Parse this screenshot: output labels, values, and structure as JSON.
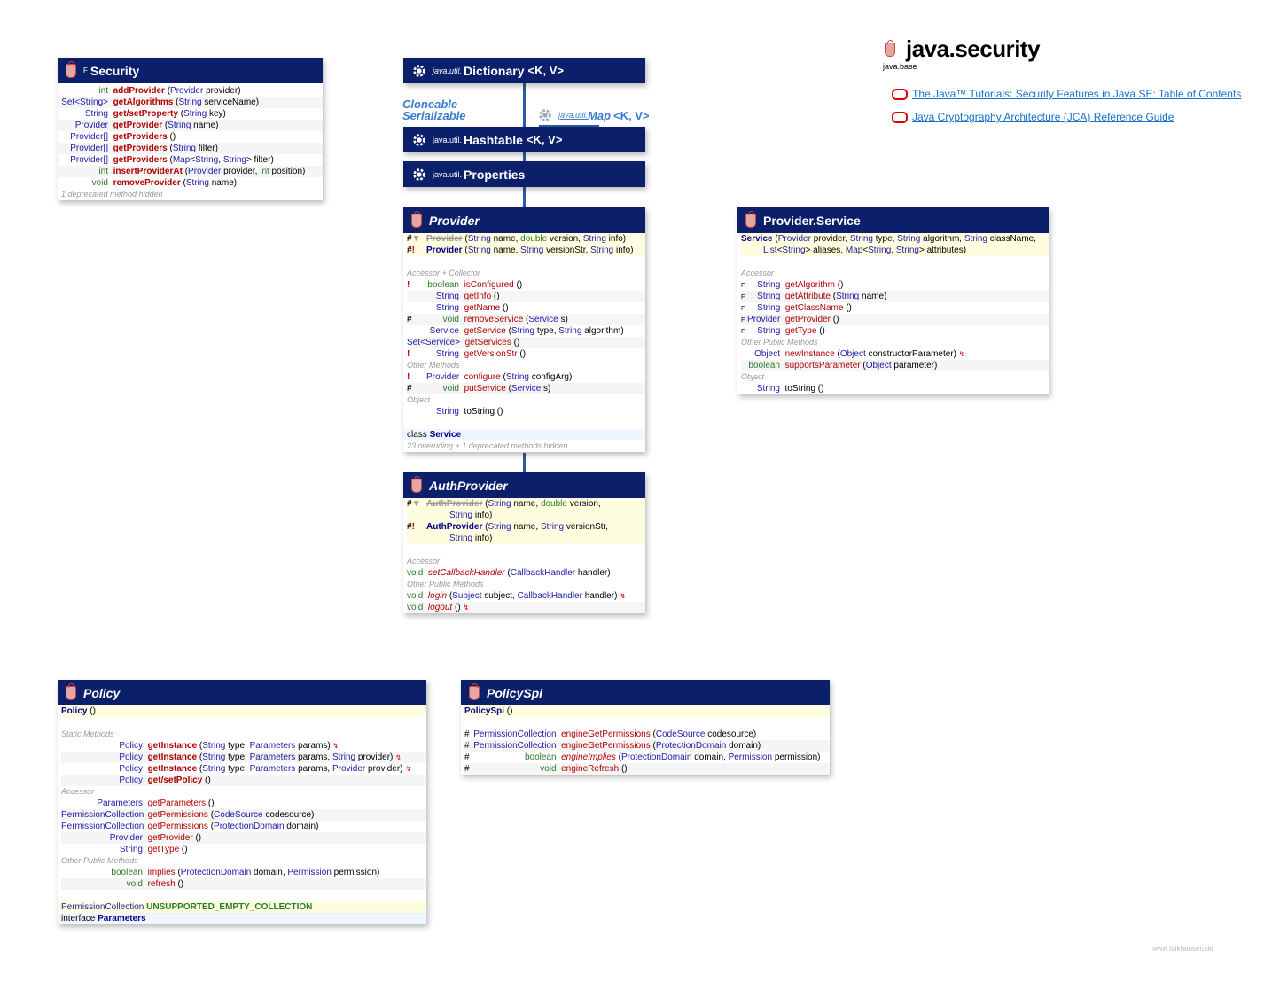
{
  "title": {
    "name": "java.security",
    "module": "java.base"
  },
  "links": [
    {
      "text": "The Java™ Tutorials: Security Features in Java SE: Table of Contents"
    },
    {
      "text": "Java Cryptography Architecture (JCA) Reference Guide"
    }
  ],
  "watermark": "www.falkhausen.de",
  "inherit": {
    "dictionary": {
      "pkg": "java.util.",
      "name": "Dictionary",
      "tp": "<K, V>"
    },
    "hashtable": {
      "pkg": "java.util.",
      "name": "Hashtable",
      "tp": "<K, V>"
    },
    "properties": {
      "pkg": "java.util.",
      "name": "Properties"
    },
    "map": {
      "pkg": "java.util.",
      "name": "Map",
      "tp": "<K, V>"
    },
    "cloneable": "Cloneable",
    "serializable": "Serializable"
  },
  "security": {
    "fin": "F",
    "name": "Security",
    "rows": [
      {
        "t": "int",
        "m": "addProvider",
        "p": [
          [
            "(",
            "t"
          ],
          [
            "Provider",
            "c"
          ],
          [
            " provider)",
            "t"
          ]
        ]
      },
      {
        "t": "Set<String>",
        "m": "getAlgorithms",
        "p": [
          [
            "(",
            "t"
          ],
          [
            "String",
            "c"
          ],
          [
            " serviceName)",
            "t"
          ]
        ]
      },
      {
        "t": "String",
        "m": "get/setProperty",
        "p": [
          [
            "(",
            "t"
          ],
          [
            "String",
            "c"
          ],
          [
            " key)",
            "t"
          ]
        ]
      },
      {
        "t": "Provider",
        "m": "getProvider",
        "p": [
          [
            "(",
            "t"
          ],
          [
            "String",
            "c"
          ],
          [
            " name)",
            "t"
          ]
        ]
      },
      {
        "t": "Provider[]",
        "m": "getProviders",
        "p": [
          [
            "()",
            "t"
          ]
        ]
      },
      {
        "t": "Provider[]",
        "m": "getProviders",
        "p": [
          [
            "(",
            "t"
          ],
          [
            "String",
            "c"
          ],
          [
            " filter)",
            "t"
          ]
        ]
      },
      {
        "t": "Provider[]",
        "m": "getProviders",
        "p": [
          [
            "(",
            "t"
          ],
          [
            "Map",
            "c"
          ],
          [
            "<",
            "t"
          ],
          [
            "String",
            "c"
          ],
          [
            ", ",
            "t"
          ],
          [
            "String",
            "c"
          ],
          [
            "> filter)",
            "t"
          ]
        ]
      },
      {
        "t": "int",
        "m": "insertProviderAt",
        "p": [
          [
            "(",
            "t"
          ],
          [
            "Provider",
            "c"
          ],
          [
            " provider, ",
            "t"
          ],
          [
            "int",
            "c"
          ],
          [
            " position)",
            "t"
          ]
        ]
      },
      {
        "t": "void",
        "m": "removeProvider",
        "p": [
          [
            "(",
            "t"
          ],
          [
            "String",
            "c"
          ],
          [
            " name)",
            "t"
          ]
        ]
      }
    ],
    "footer": "1 deprecated method hidden"
  },
  "provider": {
    "name": "Provider",
    "ctor1": "Provider (String name, double version, String info)",
    "ctor2": "Provider (String name, String versionStr, String info)",
    "sec_accessor": "Accessor + Collector",
    "sec_other": "Other Methods",
    "sec_object": "Object",
    "inner": "class Service",
    "footer": "23 overriding + 1 deprecated methods hidden"
  },
  "authprovider": {
    "name": "AuthProvider",
    "sec_accessor": "Accessor",
    "sec_other": "Other Public Methods"
  },
  "service": {
    "name": "Provider.Service",
    "sec_accessor": "Accessor",
    "sec_other": "Other Public Methods",
    "sec_object": "Object"
  },
  "policy": {
    "name": "Policy",
    "sec_static": "Static Methods",
    "sec_accessor": "Accessor",
    "sec_other": "Other Public Methods",
    "field": "UNSUPPORTED_EMPTY_COLLECTION",
    "inner": "interface Parameters"
  },
  "policyspi": {
    "name": "PolicySpi"
  }
}
